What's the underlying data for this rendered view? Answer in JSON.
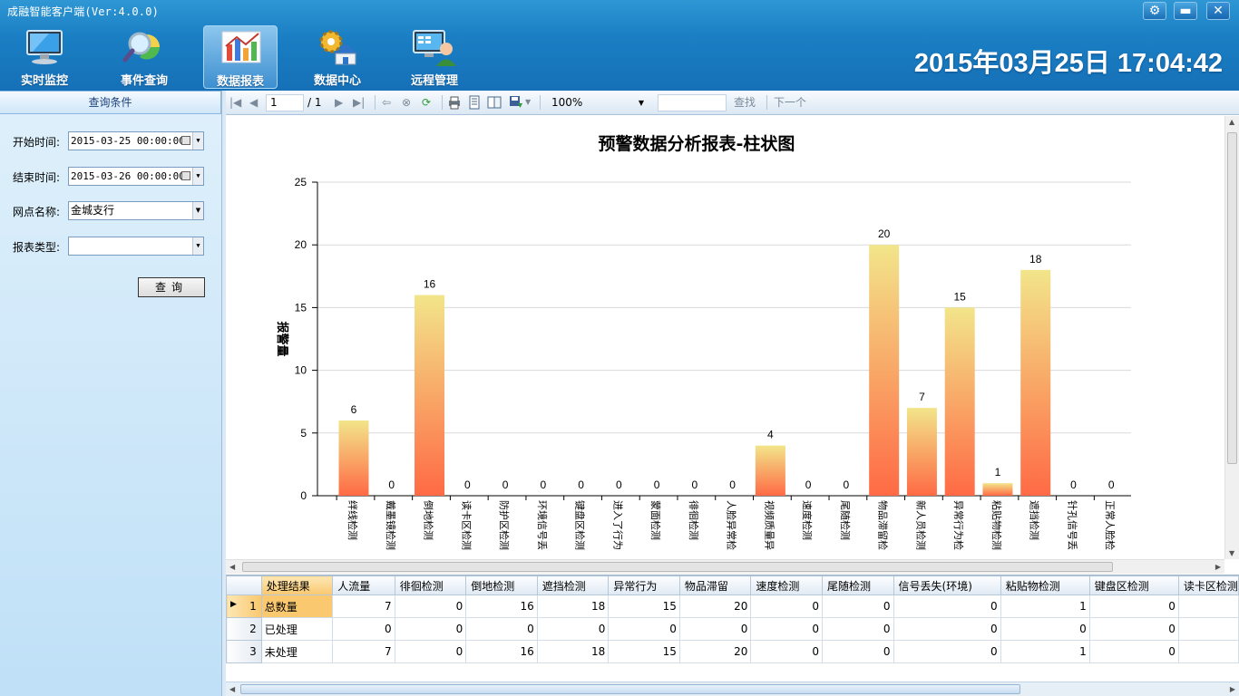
{
  "app": {
    "title": "成融智能客户端(Ver:4.0.0)",
    "datetime": "2015年03月25日 17:04:42"
  },
  "window_controls": {
    "settings": "⚙",
    "minimize": "▬",
    "close": "✕"
  },
  "nav": {
    "items": [
      {
        "label": "实时监控",
        "icon": "monitor-icon",
        "active": false
      },
      {
        "label": "事件查询",
        "icon": "magnifier-pie-icon",
        "active": false
      },
      {
        "label": "数据报表",
        "icon": "bar-chart-icon",
        "active": true
      },
      {
        "label": "数据中心",
        "icon": "gear-house-icon",
        "active": false
      },
      {
        "label": "远程管理",
        "icon": "remote-user-icon",
        "active": false
      }
    ]
  },
  "query": {
    "header": "查询条件",
    "start_label": "开始时间:",
    "start_value": "2015-03-25 00:00:00",
    "end_label": "结束时间:",
    "end_value": "2015-03-26 00:00:00",
    "branch_label": "网点名称:",
    "branch_value": "金城支行",
    "type_label": "报表类型:",
    "type_value": "",
    "button": "查询"
  },
  "toolbar": {
    "page": "1",
    "page_total": "/ 1",
    "zoom": "100%",
    "find": "查找",
    "next": "下一个"
  },
  "chart_data": {
    "type": "bar",
    "title": "预警数据分析报表-柱状图",
    "ylabel": "报警量",
    "xlabel": "",
    "ylim": [
      0,
      25
    ],
    "yticks": [
      0,
      5,
      10,
      15,
      20,
      25
    ],
    "categories": [
      "绊线检测",
      "戴墨镜检测",
      "倒地检测",
      "读卡区检测",
      "防护区检测",
      "环境信号丢",
      "键盘区检测",
      "进入了行为",
      "蒙面检测",
      "徘徊检测",
      "人脸异常检",
      "视频质量异",
      "速度检测",
      "尾随检测",
      "物品滞留检",
      "新人员检测",
      "异常行为检",
      "粘贴物检测",
      "遮挡检测",
      "针孔信号丢",
      "正常人脸检"
    ],
    "values": [
      6,
      0,
      16,
      0,
      0,
      0,
      0,
      0,
      0,
      0,
      0,
      4,
      0,
      0,
      20,
      7,
      15,
      1,
      18,
      0,
      0
    ],
    "bar_gradient": [
      "#f2e58a",
      "#ff6a45"
    ],
    "grid": true
  },
  "grid": {
    "columns": [
      "处理结果",
      "人流量",
      "徘徊检测",
      "倒地检测",
      "遮挡检测",
      "异常行为",
      "物品滞留",
      "速度检测",
      "尾随检测",
      "信号丢失(环境)",
      "粘贴物检测",
      "键盘区检测",
      "读卡区检测"
    ],
    "rows": [
      {
        "index": "1",
        "cells": [
          "总数量",
          "7",
          "0",
          "16",
          "18",
          "15",
          "20",
          "0",
          "0",
          "0",
          "1",
          "0",
          ""
        ]
      },
      {
        "index": "2",
        "cells": [
          "已处理",
          "0",
          "0",
          "0",
          "0",
          "0",
          "0",
          "0",
          "0",
          "0",
          "0",
          "0",
          ""
        ]
      },
      {
        "index": "3",
        "cells": [
          "未处理",
          "7",
          "0",
          "16",
          "18",
          "15",
          "20",
          "0",
          "0",
          "0",
          "1",
          "0",
          ""
        ]
      }
    ]
  }
}
